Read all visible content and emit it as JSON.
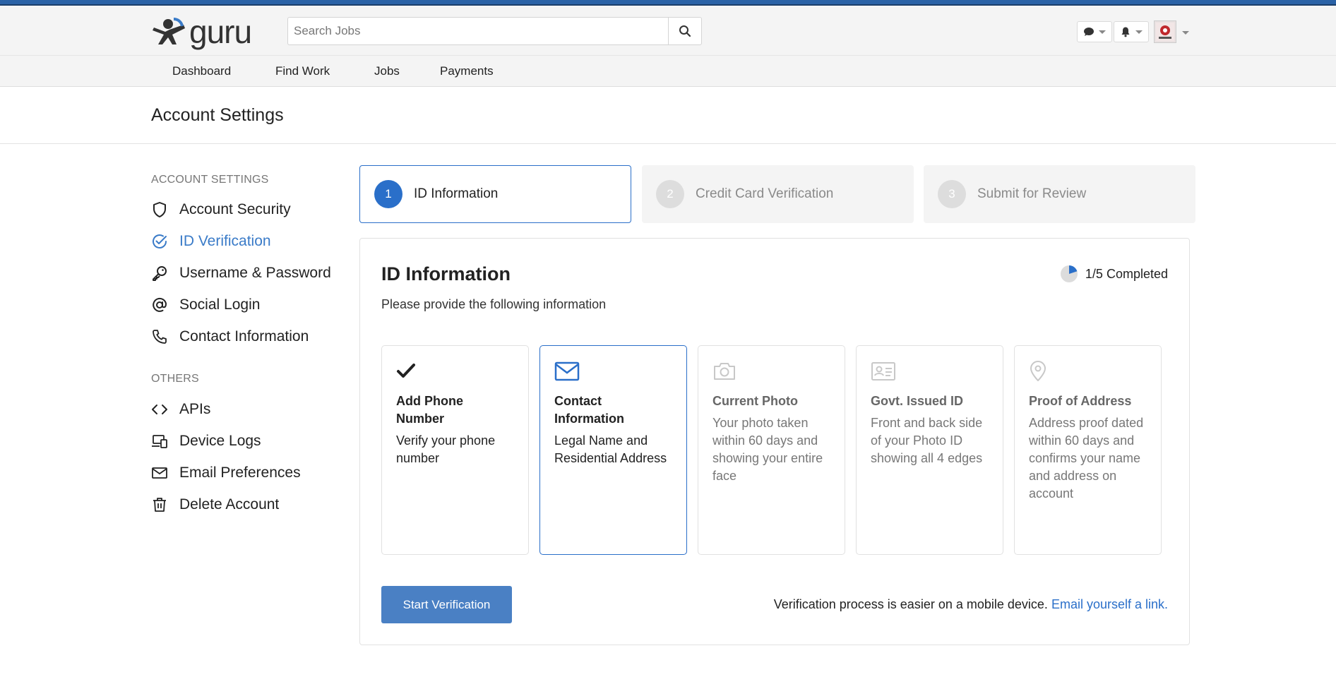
{
  "brand": {
    "name": "guru"
  },
  "search": {
    "placeholder": "Search Jobs"
  },
  "nav": [
    "Dashboard",
    "Find Work",
    "Jobs",
    "Payments"
  ],
  "page": {
    "title": "Account Settings"
  },
  "sidebar": {
    "heading_settings": "ACCOUNT SETTINGS",
    "settings_items": [
      {
        "label": "Account Security",
        "icon": "shield-icon"
      },
      {
        "label": "ID Verification",
        "icon": "check-circle-icon",
        "active": true
      },
      {
        "label": "Username & Password",
        "icon": "key-icon"
      },
      {
        "label": "Social Login",
        "icon": "at-icon"
      },
      {
        "label": "Contact Information",
        "icon": "phone-icon"
      }
    ],
    "heading_others": "OTHERS",
    "other_items": [
      {
        "label": "APIs",
        "icon": "code-icon"
      },
      {
        "label": "Device Logs",
        "icon": "devices-icon"
      },
      {
        "label": "Email Preferences",
        "icon": "mail-icon"
      },
      {
        "label": "Delete Account",
        "icon": "trash-icon"
      }
    ]
  },
  "steps": [
    {
      "num": "1",
      "label": "ID Information",
      "active": true
    },
    {
      "num": "2",
      "label": "Credit Card Verification",
      "active": false
    },
    {
      "num": "3",
      "label": "Submit for Review",
      "active": false
    }
  ],
  "panel": {
    "title": "ID Information",
    "subtitle": "Please provide the following information",
    "progress_text": "1/5 Completed",
    "progress_fraction": 0.2,
    "cards": [
      {
        "title": "Add Phone Number",
        "desc": "Verify your phone number",
        "icon": "checkmark-icon",
        "state": "done"
      },
      {
        "title": "Contact Information",
        "desc": "Legal Name and Residential Address",
        "icon": "mail-icon",
        "state": "selected"
      },
      {
        "title": "Current Photo",
        "desc": "Your photo taken within 60 days and showing your entire face",
        "icon": "camera-icon",
        "state": "pending"
      },
      {
        "title": "Govt. Issued ID",
        "desc": "Front and back side of your Photo ID showing all 4 edges",
        "icon": "id-card-icon",
        "state": "pending"
      },
      {
        "title": "Proof of Address",
        "desc": "Address proof dated within 60 days and confirms your name and address on account",
        "icon": "map-pin-icon",
        "state": "pending"
      }
    ],
    "start_button": "Start Verification",
    "mobile_note": "Verification process is easier on a mobile device.",
    "mobile_link": "Email yourself a link."
  },
  "colors": {
    "accent": "#2a6fc9",
    "button": "#4a80c4",
    "topbar": "#2a62a6"
  }
}
